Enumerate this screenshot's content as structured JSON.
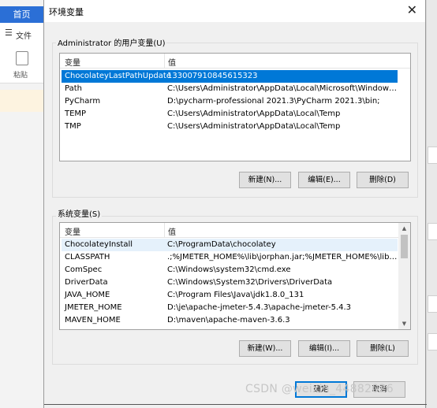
{
  "background_app": {
    "tab_label": "首页",
    "menu_label": "文件",
    "paste_label": "粘贴"
  },
  "dialog": {
    "title": "环境变量",
    "close_glyph": "✕",
    "user_vars": {
      "group_label": "Administrator 的用户变量(U)",
      "columns": [
        "变量",
        "值"
      ],
      "rows": [
        {
          "name": "ChocolateyLastPathUpdate",
          "value": "133007910845615323",
          "selected": true
        },
        {
          "name": "Path",
          "value": "C:\\Users\\Administrator\\AppData\\Local\\Microsoft\\WindowsA...",
          "selected": false
        },
        {
          "name": "PyCharm",
          "value": "D:\\pycharm-professional 2021.3\\PyCharm 2021.3\\bin;",
          "selected": false
        },
        {
          "name": "TEMP",
          "value": "C:\\Users\\Administrator\\AppData\\Local\\Temp",
          "selected": false
        },
        {
          "name": "TMP",
          "value": "C:\\Users\\Administrator\\AppData\\Local\\Temp",
          "selected": false
        }
      ],
      "buttons": {
        "new": "新建(N)...",
        "edit": "编辑(E)...",
        "delete": "删除(D)"
      }
    },
    "system_vars": {
      "group_label": "系统变量(S)",
      "columns": [
        "变量",
        "值"
      ],
      "rows": [
        {
          "name": "ChocolateyInstall",
          "value": "C:\\ProgramData\\chocolatey"
        },
        {
          "name": "CLASSPATH",
          "value": ".;%JMETER_HOME%\\lib\\jorphan.jar;%JMETER_HOME%\\lib\\lo..."
        },
        {
          "name": "ComSpec",
          "value": "C:\\Windows\\system32\\cmd.exe"
        },
        {
          "name": "DriverData",
          "value": "C:\\Windows\\System32\\Drivers\\DriverData"
        },
        {
          "name": "JAVA_HOME",
          "value": "C:\\Program Files\\Java\\jdk1.8.0_131"
        },
        {
          "name": "JMETER_HOME",
          "value": "D:\\je\\apache-jmeter-5.4.3\\apache-jmeter-5.4.3"
        },
        {
          "name": "MAVEN_HOME",
          "value": "D:\\maven\\apache-maven-3.6.3"
        }
      ],
      "buttons": {
        "new": "新建(W)...",
        "edit": "编辑(I)...",
        "delete": "删除(L)"
      }
    },
    "footer": {
      "ok": "确定",
      "cancel": "取消"
    }
  },
  "watermark": "CSDN @weixin_44882026",
  "colors": {
    "selection": "#0078d7",
    "bg_tab": "#2b6fd6"
  }
}
